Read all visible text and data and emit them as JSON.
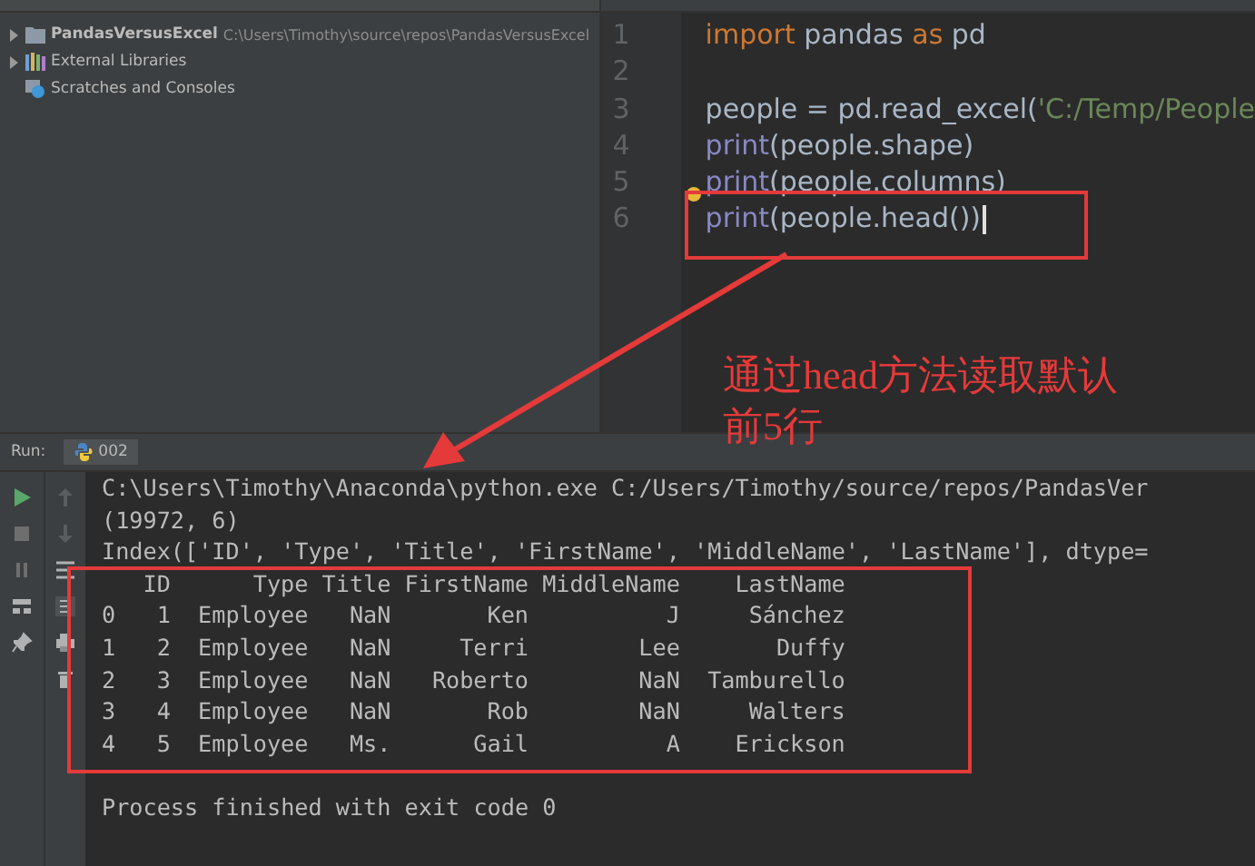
{
  "project_tree": [
    {
      "label": "PandasVersusExcel",
      "path": "C:\\Users\\Timothy\\source\\repos\\PandasVersusExcel",
      "kind": "folder",
      "expanded": false
    },
    {
      "label": "External Libraries",
      "kind": "library",
      "expanded": false
    },
    {
      "label": "Scratches and Consoles",
      "kind": "scratch"
    }
  ],
  "editor": {
    "lines": [
      {
        "number": "1",
        "tokens": [
          {
            "text": "import",
            "kind": "keyword"
          },
          {
            "text": " pandas ",
            "kind": "plain"
          },
          {
            "text": "as",
            "kind": "keyword"
          },
          {
            "text": " pd",
            "kind": "plain"
          }
        ]
      },
      {
        "number": "2"
      },
      {
        "number": "3",
        "tokens": [
          {
            "text": "people = pd.read_excel(",
            "kind": "plain"
          },
          {
            "text": "'C:/Temp/People",
            "kind": "string"
          }
        ]
      },
      {
        "number": "4",
        "tokens": [
          {
            "text": "print",
            "kind": "builtin"
          },
          {
            "text": "(people.shape)",
            "kind": "plain"
          }
        ]
      },
      {
        "number": "5",
        "tokens": [
          {
            "text": "print",
            "kind": "builtin"
          },
          {
            "text": "(people.columns)",
            "kind": "plain"
          }
        ],
        "bulb": true
      },
      {
        "number": "6",
        "tokens": [
          {
            "text": "print",
            "kind": "builtin"
          },
          {
            "text": "(people.head())",
            "kind": "plain"
          }
        ],
        "cursor": true
      }
    ]
  },
  "annotation": {
    "text": "通过head方法读取默认前5行"
  },
  "run_panel": {
    "label": "Run:",
    "tab": "002",
    "output_before": [
      "C:\\Users\\Timothy\\Anaconda\\python.exe C:/Users/Timothy/source/repos/PandasVer",
      "(19972, 6)",
      "Index(['ID', 'Type', 'Title', 'FirstName', 'MiddleName', 'LastName'], dtype="
    ],
    "table": {
      "columns": [
        "",
        "ID",
        "Type",
        "Title",
        "FirstName",
        "MiddleName",
        "LastName"
      ],
      "rows": [
        [
          "0",
          "1",
          "Employee",
          "NaN",
          "Ken",
          "J",
          "Sánchez"
        ],
        [
          "1",
          "2",
          "Employee",
          "NaN",
          "Terri",
          "Lee",
          "Duffy"
        ],
        [
          "2",
          "3",
          "Employee",
          "NaN",
          "Roberto",
          "NaN",
          "Tamburello"
        ],
        [
          "3",
          "4",
          "Employee",
          "NaN",
          "Rob",
          "NaN",
          "Walters"
        ],
        [
          "4",
          "5",
          "Employee",
          "Ms.",
          "Gail",
          "A",
          "Erickson"
        ]
      ]
    },
    "output_after": "Process finished with exit code 0"
  }
}
